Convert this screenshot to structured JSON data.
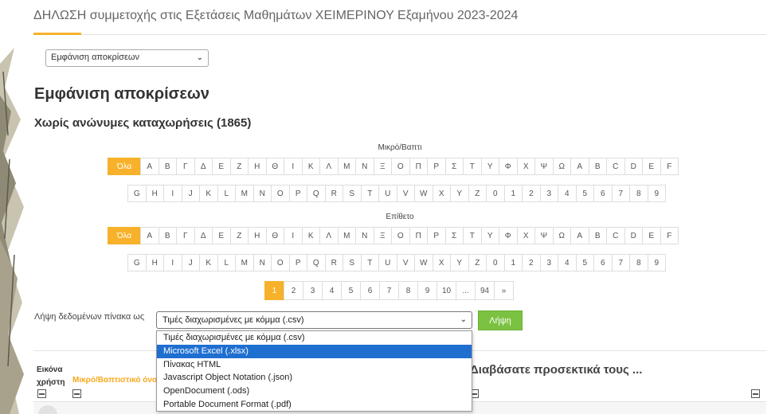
{
  "page": {
    "title": "ΔΗΛΩΣΗ συμμετοχής στις Εξετάσεις Μαθημάτων ΧΕΙΜΕΡΙΝΟΥ Εξαμήνου 2023-2024",
    "view_select": "Εμφάνιση αποκρίσεων",
    "heading": "Εμφάνιση αποκρίσεων",
    "subheading": "Χωρίς ανώνυμες καταχωρήσεις (1865)"
  },
  "filters": {
    "firstname_caption": "Μικρό/Βαπτι",
    "lastname_caption": "Επίθετο",
    "all_label": "Όλα",
    "row1": [
      "Α",
      "Β",
      "Γ",
      "Δ",
      "Ε",
      "Ζ",
      "Η",
      "Θ",
      "Ι",
      "Κ",
      "Λ",
      "Μ",
      "Ν",
      "Ξ",
      "Ο",
      "Π",
      "Ρ",
      "Σ",
      "Τ",
      "Υ",
      "Φ",
      "Χ",
      "Ψ",
      "Ω",
      "A",
      "B",
      "C",
      "D",
      "E",
      "F"
    ],
    "row2": [
      "G",
      "H",
      "I",
      "J",
      "K",
      "L",
      "M",
      "N",
      "O",
      "P",
      "Q",
      "R",
      "S",
      "T",
      "U",
      "V",
      "W",
      "X",
      "Y",
      "Z",
      "0",
      "1",
      "2",
      "3",
      "4",
      "5",
      "6",
      "7",
      "8",
      "9"
    ]
  },
  "pagination": {
    "pages": [
      "1",
      "2",
      "3",
      "4",
      "5",
      "6",
      "7",
      "8",
      "9",
      "10",
      "...",
      "94",
      "»"
    ],
    "active": "1"
  },
  "export": {
    "label": "Λήψη δεδομένων πίνακα ως",
    "selected": "Τιμές διαχωρισμένες με κόμμα (.csv)",
    "button": "Λήψη",
    "options": [
      "Τιμές διαχωρισμένες με κόμμα (.csv)",
      "Microsoft Excel (.xlsx)",
      "Πίνακας HTML",
      "Javascript Object Notation (.json)",
      "OpenDocument (.ods)",
      "Portable Document Format (.pdf)"
    ],
    "highlighted": "Microsoft Excel (.xlsx)"
  },
  "table": {
    "col_avatar_line1": "Εικόνα",
    "col_avatar_line2": "χρήστη",
    "col_name": "Μικρό/Βαπτιστικό όνομα",
    "col_question": "Διαβάσατε προσεκτικά τους ..."
  },
  "colors": {
    "accent": "#f7b12a",
    "button_green": "#7cc242",
    "selection_blue": "#1f6fd1"
  }
}
